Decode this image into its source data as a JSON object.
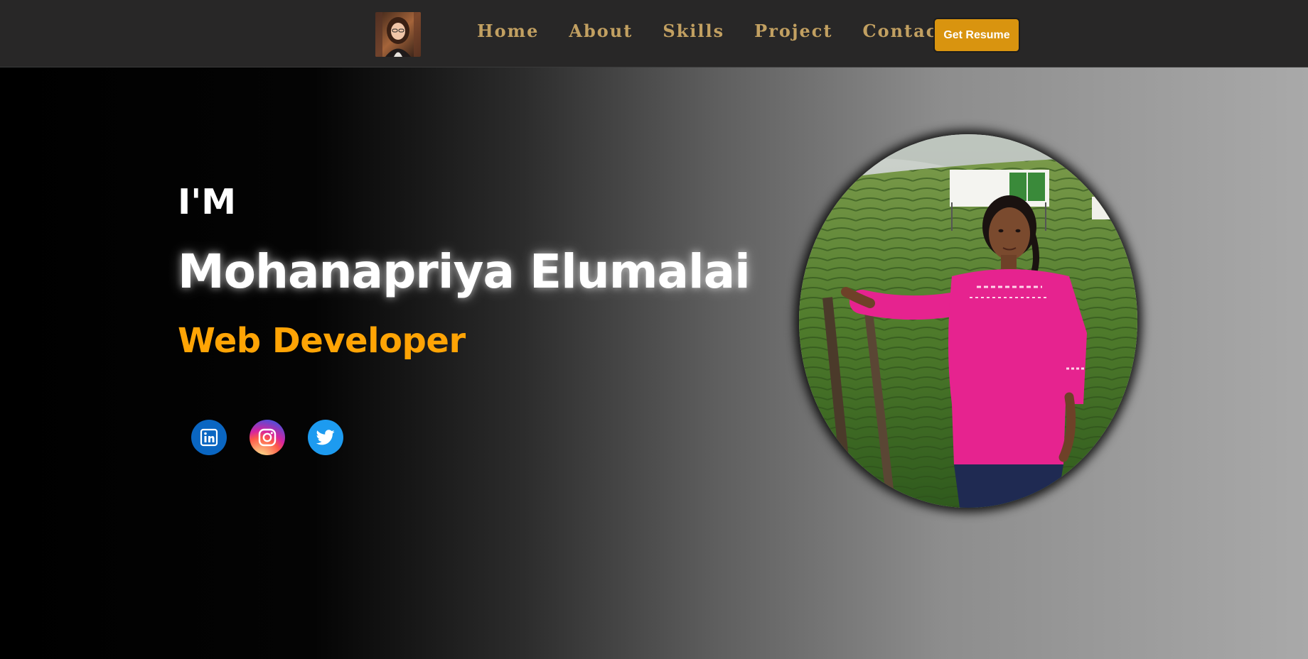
{
  "nav": {
    "links": [
      {
        "label": "Home"
      },
      {
        "label": "About"
      },
      {
        "label": "Skills"
      },
      {
        "label": "Project"
      },
      {
        "label": "Contact"
      }
    ],
    "resume_button": "Get Resume"
  },
  "hero": {
    "intro": "I'M",
    "name": "Mohanapriya Elumalai",
    "role": "Web Developer",
    "socials": [
      {
        "icon": "linkedin-icon"
      },
      {
        "icon": "instagram-icon"
      },
      {
        "icon": "twitter-icon"
      }
    ]
  },
  "colors": {
    "nav_bg": "#282727",
    "nav_link": "#c2a061",
    "accent": "#ffa405",
    "button": "#d9940f"
  }
}
